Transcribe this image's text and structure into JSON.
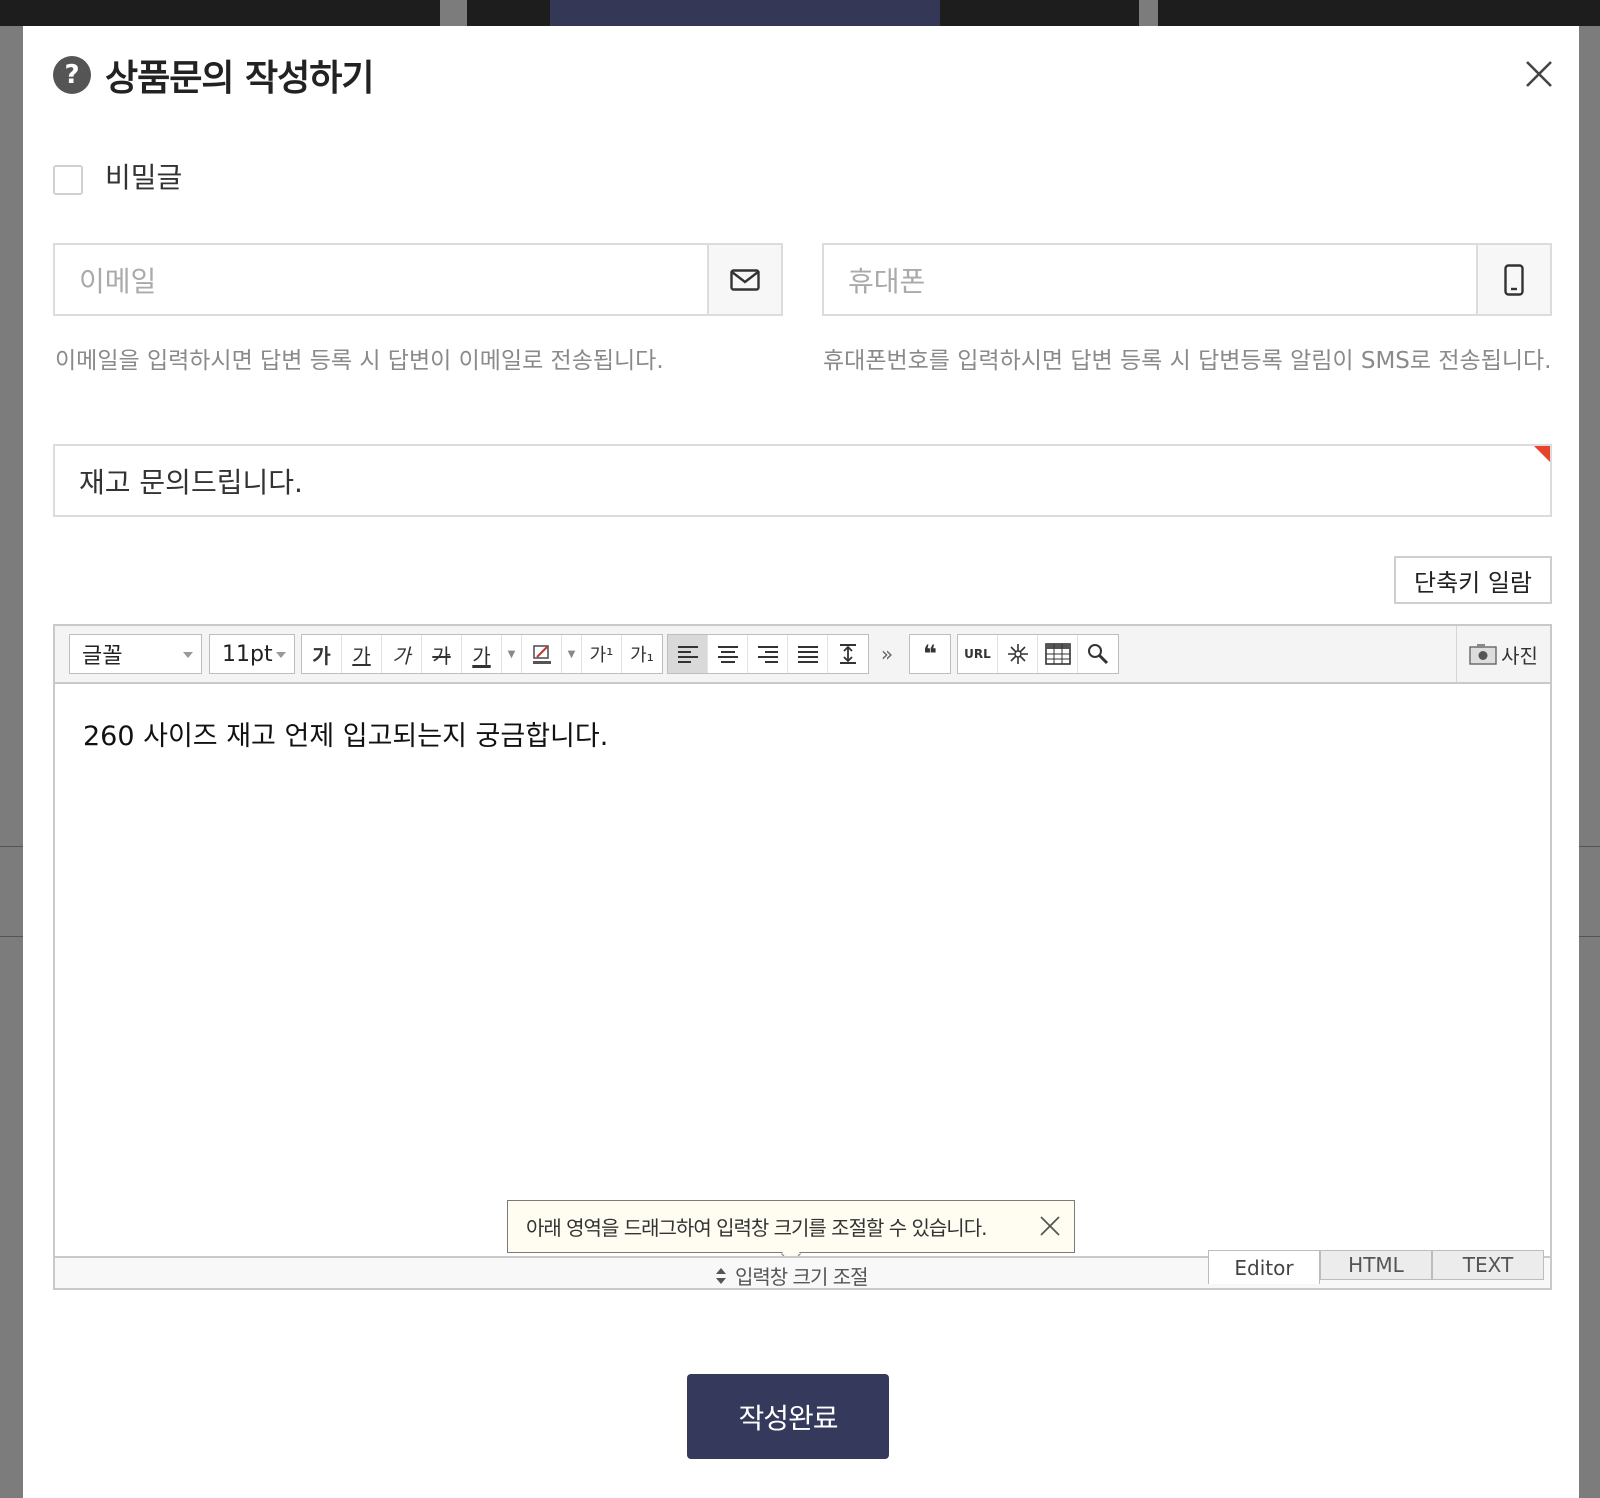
{
  "dialog": {
    "title": "상품문의 작성하기",
    "help_icon_glyph": "?",
    "close_icon": "close-icon"
  },
  "secret": {
    "label": "비밀글",
    "checked": false
  },
  "email": {
    "placeholder": "이메일",
    "hint": "이메일을 입력하시면 답변 등록 시 답변이 이메일로 전송됩니다.",
    "icon": "envelope-icon"
  },
  "phone": {
    "placeholder": "휴대폰",
    "hint": "휴대폰번호를 입력하시면 답변 등록 시 답변등록 알림이 SMS로 전송됩니다.",
    "icon": "mobile-phone-icon"
  },
  "subject": {
    "value": "재고 문의드립니다."
  },
  "shortcut_button": "단축키 일람",
  "toolbar": {
    "font_select": "글꼴",
    "size_select": "11pt",
    "format_buttons": [
      "가",
      "가",
      "가",
      "가",
      "가"
    ],
    "script_buttons": [
      "가¹",
      "가₁"
    ],
    "url_button": "URL",
    "photo_button": "사진",
    "more_glyph": "»",
    "quote_glyph": "❝"
  },
  "editor": {
    "content": "260 사이즈 재고 언제 입고되는지 궁금합니다.",
    "tooltip": "아래 영역을 드래그하여 입력창 크기를 조절할 수 있습니다.",
    "resize_label": "입력창 크기 조절",
    "mode_tabs": [
      "Editor",
      "HTML",
      "TEXT"
    ],
    "active_mode": "Editor"
  },
  "submit_button": "작성완료",
  "colors": {
    "primary": "#353a5c",
    "required_marker": "#e8442c",
    "tooltip_bg": "#fffdf2"
  }
}
